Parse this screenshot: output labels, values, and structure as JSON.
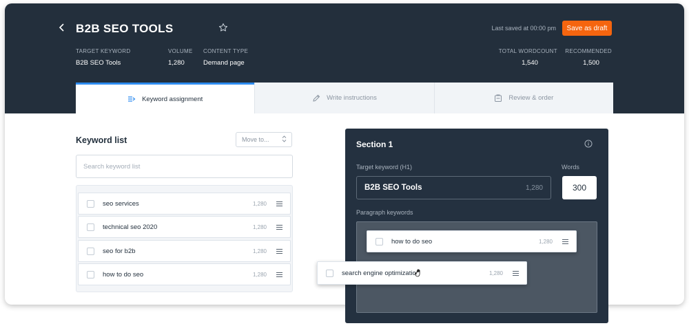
{
  "header": {
    "title": "B2B SEO TOOLS",
    "last_saved": "Last saved at 00:00 pm",
    "save_label": "Save as draft",
    "target_keyword_label": "TARGET KEYWORD",
    "target_keyword_value": "B2B SEO Tools",
    "volume_label": "VOLUME",
    "volume_value": "1,280",
    "content_type_label": "CONTENT TYPE",
    "content_type_value": "Demand page",
    "total_wordcount_label": "TOTAL WORDCOUNT",
    "total_wordcount_value": "1,540",
    "recommended_label": "RECOMMENDED",
    "recommended_value": "1,500"
  },
  "tabs": [
    {
      "label": "Keyword assignment",
      "icon": "list-arrow-icon",
      "active": true
    },
    {
      "label": "Write instructions",
      "icon": "pencil-icon",
      "active": false
    },
    {
      "label": "Review & order",
      "icon": "review-icon",
      "active": false
    }
  ],
  "keyword_list": {
    "title": "Keyword list",
    "move_to": "Move to...",
    "search_placeholder": "Search keyword list",
    "items": [
      {
        "keyword": "seo services",
        "volume": "1,280"
      },
      {
        "keyword": "technical seo 2020",
        "volume": "1,280"
      },
      {
        "keyword": "seo for b2b",
        "volume": "1,280"
      },
      {
        "keyword": "how to do seo",
        "volume": "1,280"
      }
    ]
  },
  "section": {
    "title": "Section 1",
    "target_keyword_label": "Target keyword (H1)",
    "target_keyword": "B2B SEO Tools",
    "target_volume": "1,280",
    "words_label": "Words",
    "words_value": "300",
    "paragraph_label": "Paragraph keywords",
    "paragraph_items": [
      {
        "keyword": "how to do seo",
        "volume": "1,280"
      }
    ]
  },
  "dragging_item": {
    "keyword": "search engine optimization",
    "volume": "1,280"
  },
  "colors": {
    "header_bg": "#232f3c",
    "accent": "#f5650f",
    "tab_active": "#2e8cf0"
  }
}
